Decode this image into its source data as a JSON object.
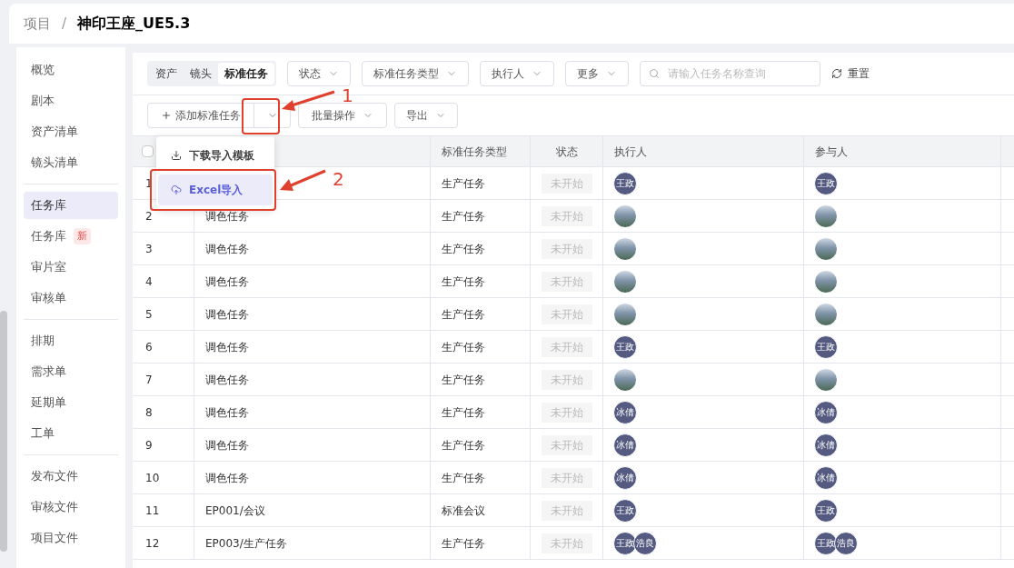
{
  "header": {
    "breadcrumb": [
      "项目",
      "神印王座_UE5.3"
    ],
    "separator": "/"
  },
  "sidebar": {
    "groups": [
      [
        {
          "label": "概览",
          "selected": false
        },
        {
          "label": "剧本",
          "selected": false
        },
        {
          "label": "资产清单",
          "selected": false
        },
        {
          "label": "镜头清单",
          "selected": false
        }
      ],
      [
        {
          "label": "任务库",
          "selected": true
        },
        {
          "label": "任务库",
          "selected": false,
          "badge": "新"
        },
        {
          "label": "审片室",
          "selected": false
        },
        {
          "label": "审核单",
          "selected": false
        }
      ],
      [
        {
          "label": "排期",
          "selected": false
        },
        {
          "label": "需求单",
          "selected": false
        },
        {
          "label": "延期单",
          "selected": false
        },
        {
          "label": "工单",
          "selected": false
        }
      ],
      [
        {
          "label": "发布文件",
          "selected": false
        },
        {
          "label": "审核文件",
          "selected": false
        },
        {
          "label": "项目文件",
          "selected": false
        }
      ]
    ]
  },
  "filters": {
    "tabs": [
      {
        "label": "资产",
        "selected": false
      },
      {
        "label": "镜头",
        "selected": false
      },
      {
        "label": "标准任务",
        "selected": true
      }
    ],
    "dropdowns": [
      "状态",
      "标准任务类型",
      "执行人",
      "更多"
    ],
    "search": {
      "placeholder": "请输入任务名称查询"
    },
    "reset": "重置"
  },
  "actions": {
    "add": "添加标准任务",
    "batch": "批量操作",
    "export": "导出"
  },
  "menu": {
    "items": [
      {
        "label": "下载导入模板",
        "kind": "download",
        "selected": false
      },
      {
        "label": "Excel导入",
        "kind": "upload",
        "selected": true
      }
    ]
  },
  "table": {
    "header_checkbox": {
      "checked": false
    },
    "columns": [
      "标准任务类型",
      "状态",
      "执行人",
      "参与人"
    ],
    "rows": [
      {
        "index": "1",
        "type": "生产任务",
        "status": "未开始",
        "executors": [
          {
            "kind": "initials",
            "text": "王政"
          }
        ],
        "participants": [
          {
            "kind": "initials",
            "text": "王政"
          }
        ]
      },
      {
        "index": "2",
        "name": "调色任务",
        "type": "生产任务",
        "status": "未开始",
        "executors": [
          {
            "kind": "photo"
          }
        ],
        "participants": [
          {
            "kind": "photo"
          }
        ]
      },
      {
        "index": "3",
        "name": "调色任务",
        "type": "生产任务",
        "status": "未开始",
        "executors": [
          {
            "kind": "photo"
          }
        ],
        "participants": [
          {
            "kind": "photo"
          }
        ]
      },
      {
        "index": "4",
        "name": "调色任务",
        "type": "生产任务",
        "status": "未开始",
        "executors": [
          {
            "kind": "photo"
          }
        ],
        "participants": [
          {
            "kind": "photo"
          }
        ]
      },
      {
        "index": "5",
        "name": "调色任务",
        "type": "生产任务",
        "status": "未开始",
        "executors": [
          {
            "kind": "photo"
          }
        ],
        "participants": [
          {
            "kind": "photo"
          }
        ]
      },
      {
        "index": "6",
        "name": "调色任务",
        "type": "生产任务",
        "status": "未开始",
        "executors": [
          {
            "kind": "initials",
            "text": "王政"
          }
        ],
        "participants": [
          {
            "kind": "initials",
            "text": "王政"
          }
        ]
      },
      {
        "index": "7",
        "name": "调色任务",
        "type": "生产任务",
        "status": "未开始",
        "executors": [
          {
            "kind": "photo"
          }
        ],
        "participants": [
          {
            "kind": "photo"
          }
        ]
      },
      {
        "index": "8",
        "name": "调色任务",
        "type": "生产任务",
        "status": "未开始",
        "executors": [
          {
            "kind": "initials",
            "text": "冰倩"
          }
        ],
        "participants": [
          {
            "kind": "initials",
            "text": "冰倩"
          }
        ]
      },
      {
        "index": "9",
        "name": "调色任务",
        "type": "生产任务",
        "status": "未开始",
        "executors": [
          {
            "kind": "initials",
            "text": "冰倩"
          }
        ],
        "participants": [
          {
            "kind": "initials",
            "text": "冰倩"
          }
        ]
      },
      {
        "index": "10",
        "name": "调色任务",
        "type": "生产任务",
        "status": "未开始",
        "executors": [
          {
            "kind": "initials",
            "text": "冰倩"
          }
        ],
        "participants": [
          {
            "kind": "initials",
            "text": "冰倩"
          }
        ]
      },
      {
        "index": "11",
        "name": "EP001/会议",
        "type": "标准会议",
        "status": "未开始",
        "executors": [
          {
            "kind": "initials",
            "text": "王政"
          }
        ],
        "participants": [
          {
            "kind": "initials",
            "text": "王政"
          }
        ]
      },
      {
        "index": "12",
        "name": "EP003/生产任务",
        "type": "生产任务",
        "status": "未开始",
        "executors": [
          {
            "kind": "initials",
            "text": "王政"
          },
          {
            "kind": "initials",
            "text": "浩良"
          }
        ],
        "participants": [
          {
            "kind": "initials",
            "text": "王政"
          },
          {
            "kind": "initials",
            "text": "浩良"
          }
        ]
      }
    ]
  },
  "annotations": [
    {
      "label": "1"
    },
    {
      "label": "2"
    }
  ]
}
